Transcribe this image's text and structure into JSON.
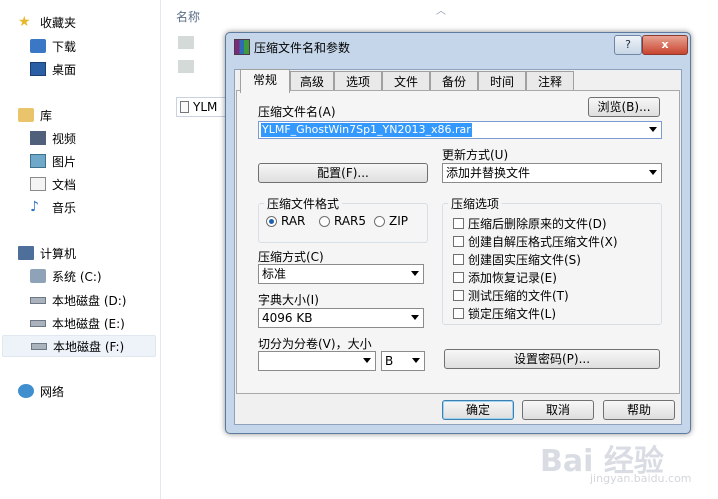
{
  "explorer": {
    "sidebar": {
      "favorites": {
        "label": "收藏夹",
        "items": [
          "下载",
          "桌面"
        ]
      },
      "libraries": {
        "label": "库",
        "items": [
          "视频",
          "图片",
          "文档",
          "音乐"
        ]
      },
      "computer": {
        "label": "计算机",
        "items": [
          "系统 (C:)",
          "本地磁盘 (D:)",
          "本地磁盘 (E:)",
          "本地磁盘 (F:)"
        ]
      },
      "network": {
        "label": "网络"
      }
    },
    "column_header": "名称",
    "file_item": "YLM"
  },
  "dialog": {
    "title": "压缩文件名和参数",
    "help_label": "?",
    "close_label": "x",
    "tabs": [
      "常规",
      "高级",
      "选项",
      "文件",
      "备份",
      "时间",
      "注释"
    ],
    "archive_name_label": "压缩文件名(A)",
    "browse_label": "浏览(B)...",
    "archive_name_value": "YLMF_GhostWin7Sp1_YN2013_x86.rar",
    "update_mode_label": "更新方式(U)",
    "update_mode_value": "添加并替换文件",
    "profiles_label": "配置(F)...",
    "format_group_label": "压缩文件格式",
    "formats": [
      "RAR",
      "RAR5",
      "ZIP"
    ],
    "method_label": "压缩方式(C)",
    "method_value": "标准",
    "dict_label": "字典大小(I)",
    "dict_value": "4096 KB",
    "split_label": "切分为分卷(V)，大小",
    "split_value": "",
    "split_unit": "B",
    "options_group_label": "压缩选项",
    "options": [
      "压缩后删除原来的文件(D)",
      "创建自解压格式压缩文件(X)",
      "创建固实压缩文件(S)",
      "添加恢复记录(E)",
      "测试压缩的文件(T)",
      "锁定压缩文件(L)"
    ],
    "password_label": "设置密码(P)...",
    "ok_label": "确定",
    "cancel_label": "取消",
    "help_button_label": "帮助"
  },
  "watermark": {
    "main": "Bai 经验",
    "sub": "jingyan.baidu.com"
  },
  "colors": {
    "selection": "#3399ff",
    "dialog_frame": "#c5d6ea",
    "close_button": "#c8442f"
  }
}
